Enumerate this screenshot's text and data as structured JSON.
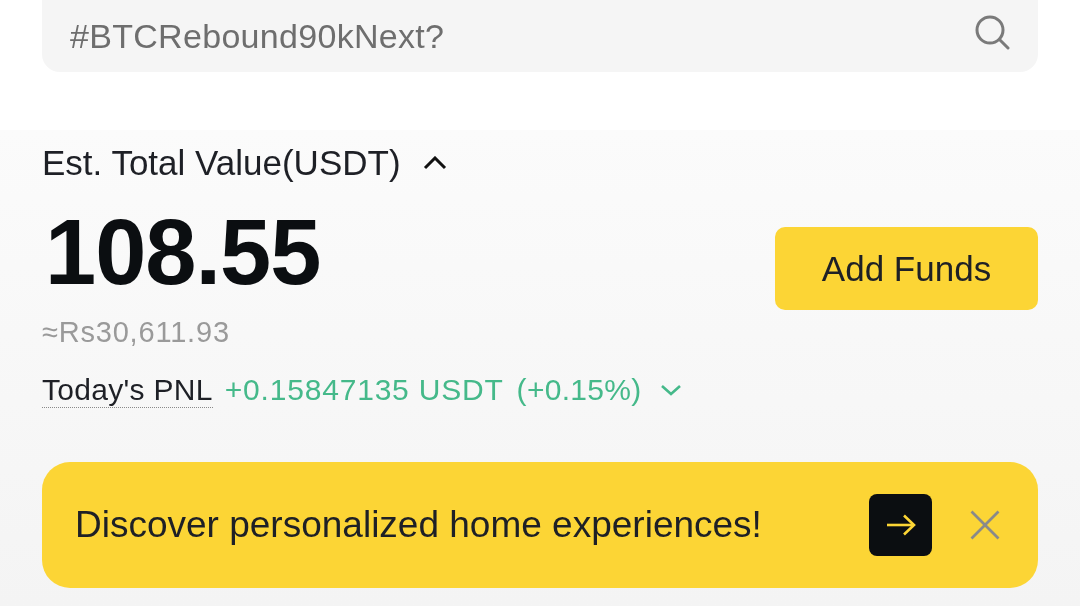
{
  "search": {
    "placeholder": "#BTCRebound90kNext?"
  },
  "balance": {
    "title": "Est. Total Value(USDT)",
    "value": "108.55",
    "fiat_estimate": "≈Rs30,611.93",
    "pnl_label": "Today's PNL",
    "pnl_value": "+0.15847135 USDT",
    "pnl_percent": "(+0.15%)",
    "add_funds_button": "Add Funds"
  },
  "banner": {
    "text": "Discover personalized home experiences!"
  }
}
